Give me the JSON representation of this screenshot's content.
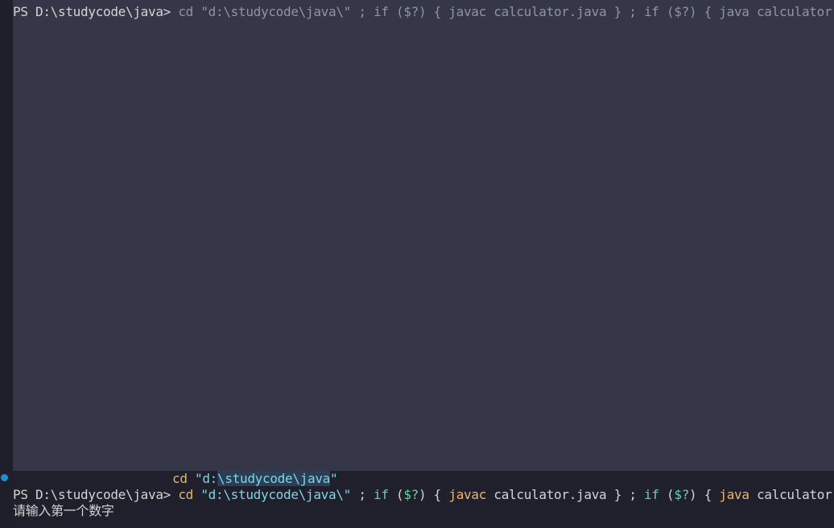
{
  "terminal": {
    "prompt": "PS D:\\studycode\\java> ",
    "ghost_command": "cd \"d:\\studycode\\java\\\" ; if ($?) { javac calculator.java } ; if ($?) { java calculator }",
    "suggestion": {
      "cmd": "cd",
      "space": " ",
      "arg_prefix": "\"d:",
      "arg_highlight": "\\studycode\\java",
      "arg_suffix": "\""
    },
    "active_command": {
      "cd": "cd",
      "path": " \"d:\\studycode\\java\\\"",
      "sep1": " ; ",
      "if1": "if",
      "cond1_open": " (",
      "cond1_var": "$?",
      "cond1_close": ") { ",
      "javac": "javac",
      "javac_arg": " calculator.java } ; ",
      "if2": "if",
      "cond2_open": " (",
      "cond2_var": "$?",
      "cond2_close": ") { ",
      "java": "java",
      "java_arg": " calculator }"
    },
    "output_line": "请输入第一个数字"
  },
  "colors": {
    "background": "#1f202c",
    "overlay": "#353748",
    "marker": "#1f8fce",
    "string": "#7fd6e8",
    "keyword": "#64d2a8",
    "executable": "#f0b46a"
  }
}
